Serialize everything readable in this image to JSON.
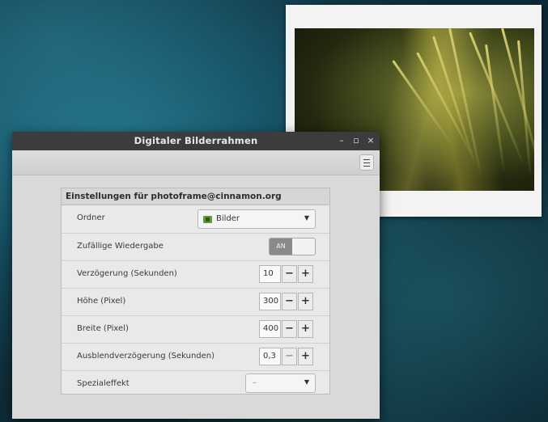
{
  "window": {
    "title": "Digitaler Bilderrahmen",
    "minimize_glyph": "–",
    "maximize_glyph": "▫",
    "close_glyph": "×"
  },
  "section": {
    "header": "Einstellungen für photoframe@cinnamon.org"
  },
  "settings": {
    "folder": {
      "label": "Ordner",
      "value": "Bilder",
      "icon": "folder-icon"
    },
    "shuffle": {
      "label": "Zufällige Wiedergabe",
      "toggle_text": "AN",
      "state": "on"
    },
    "delay": {
      "label": "Verzögerung (Sekunden)",
      "value": "10"
    },
    "height": {
      "label": "Höhe (Pixel)",
      "value": "300"
    },
    "width": {
      "label": "Breite (Pixel)",
      "value": "400"
    },
    "fade_delay": {
      "label": "Ausblendverzögerung (Sekunden)",
      "value": "0,3"
    },
    "effect": {
      "label": "Spezialeffekt",
      "value": "–"
    }
  },
  "stepper_glyphs": {
    "minus": "−",
    "plus": "+"
  },
  "colors": {
    "titlebar": "#3c3c3c",
    "toggle_on": "#8a8a8a",
    "folder_icon": "#5f9a3c"
  }
}
